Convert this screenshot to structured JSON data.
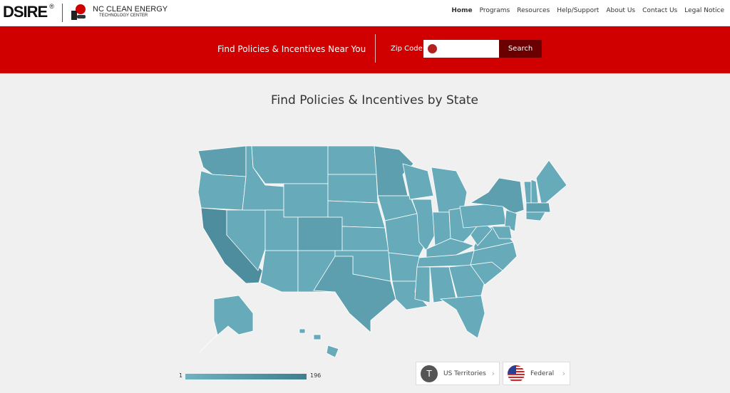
{
  "header": {
    "logo": "DSIRE",
    "logo_mark": "®",
    "partner_line1": "NC CLEAN ENERGY",
    "partner_line2": "TECHNOLOGY CENTER",
    "nav": [
      "Home",
      "Programs",
      "Resources",
      "Help/Support",
      "About Us",
      "Contact Us",
      "Legal Notice"
    ]
  },
  "search": {
    "title": "Find Policies & Incentives Near You",
    "zip_label": "Zip Code",
    "zip_value": "",
    "zip_placeholder": "",
    "button": "Search"
  },
  "main": {
    "title": "Find Policies & Incentives by State"
  },
  "legend": {
    "min": "1",
    "max": "196",
    "color_min": "#6fb2c0",
    "color_max": "#3f7f8f"
  },
  "cards": [
    {
      "icon": "T",
      "label": "US Territories"
    },
    {
      "icon": "us-flag-icon",
      "label": "Federal"
    }
  ],
  "colors": {
    "accent": "#d10000",
    "search_button": "#6b0000",
    "state_base": "#67abba",
    "state_dark": "#4d8d9d"
  }
}
